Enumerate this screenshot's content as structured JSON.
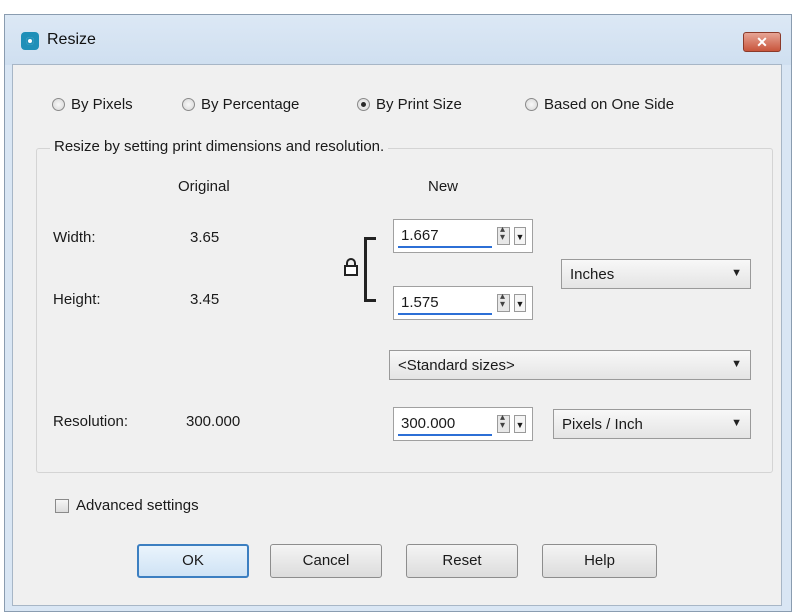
{
  "window": {
    "title": "Resize",
    "close_label": "✕"
  },
  "mode_options": [
    {
      "label": "By Pixels",
      "selected": false
    },
    {
      "label": "By Percentage",
      "selected": false
    },
    {
      "label": "By Print Size",
      "selected": true
    },
    {
      "label": "Based on One Side",
      "selected": false
    }
  ],
  "group": {
    "legend": "Resize by setting print dimensions and resolution."
  },
  "headers": {
    "original": "Original",
    "new": "New"
  },
  "rows": {
    "width": {
      "label": "Width:",
      "original": "3.65",
      "new": "1.667"
    },
    "height": {
      "label": "Height:",
      "original": "3.45",
      "new": "1.575"
    },
    "resolution": {
      "label": "Resolution:",
      "original": "300.000",
      "new": "300.000"
    }
  },
  "units": {
    "size_unit": "Inches",
    "standard_sizes": "<Standard sizes>",
    "resolution_unit": "Pixels / Inch"
  },
  "advanced": {
    "label": "Advanced settings",
    "checked": false
  },
  "buttons": {
    "ok": "OK",
    "cancel": "Cancel",
    "reset": "Reset",
    "help": "Help"
  },
  "colors": {
    "accent_underline": "#2c6fd6",
    "close_red": "#c8553c",
    "title_bar": "#d9e6f4"
  }
}
